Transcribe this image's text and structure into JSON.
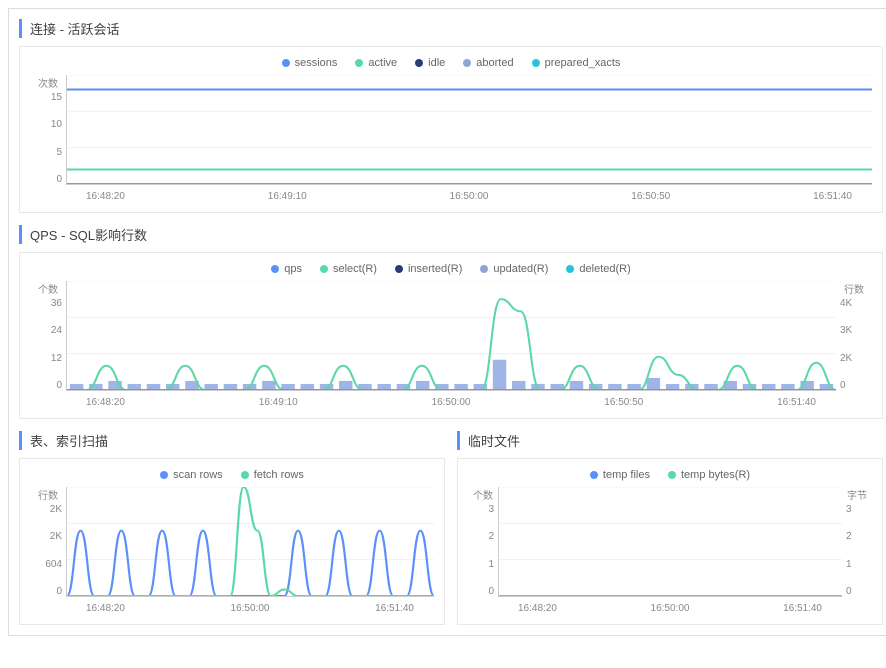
{
  "panels": {
    "sessions": {
      "title": "连接 - 活跃会话",
      "ylabel_left": "次数",
      "legend": [
        {
          "name": "sessions",
          "color": "#5b8ff9"
        },
        {
          "name": "active",
          "color": "#5ad8a6"
        },
        {
          "name": "idle",
          "color": "#2b3b7a"
        },
        {
          "name": "aborted",
          "color": "#8fa4d6"
        },
        {
          "name": "prepared_xacts",
          "color": "#29c3d8"
        }
      ]
    },
    "qps": {
      "title": "QPS - SQL影响行数",
      "ylabel_left": "个数",
      "ylabel_right": "行数",
      "legend": [
        {
          "name": "qps",
          "color": "#5b8ff9"
        },
        {
          "name": "select(R)",
          "color": "#5ad8a6"
        },
        {
          "name": "inserted(R)",
          "color": "#2b3b7a"
        },
        {
          "name": "updated(R)",
          "color": "#8fa4d6"
        },
        {
          "name": "deleted(R)",
          "color": "#29c3d8"
        }
      ]
    },
    "scan": {
      "title": "表、索引扫描",
      "ylabel_left": "行数",
      "legend": [
        {
          "name": "scan rows",
          "color": "#5b8ff9"
        },
        {
          "name": "fetch rows",
          "color": "#5ad8a6"
        }
      ]
    },
    "temp": {
      "title": "临时文件",
      "ylabel_left": "个数",
      "ylabel_right": "字节",
      "legend": [
        {
          "name": "temp files",
          "color": "#5b8ff9"
        },
        {
          "name": "temp bytes(R)",
          "color": "#5ad8a6"
        }
      ]
    }
  },
  "chart_data": [
    {
      "id": "sessions",
      "type": "line",
      "title": "连接 - 活跃会话",
      "xlabel": "",
      "ylabel": "次数",
      "ylim": [
        0,
        15
      ],
      "yticks": [
        0,
        5,
        10,
        15
      ],
      "x_ticks": [
        "16:48:20",
        "16:49:10",
        "16:50:00",
        "16:50:50",
        "16:51:40"
      ],
      "series": [
        {
          "name": "sessions",
          "color": "#5b8ff9",
          "flat_value": 13
        },
        {
          "name": "active",
          "color": "#5ad8a6",
          "flat_value": 2
        },
        {
          "name": "idle",
          "color": "#2b3b7a",
          "flat_value": 0
        },
        {
          "name": "aborted",
          "color": "#8fa4d6",
          "flat_value": 0
        },
        {
          "name": "prepared_xacts",
          "color": "#29c3d8",
          "flat_value": 0
        }
      ]
    },
    {
      "id": "qps",
      "type": "bar+line",
      "title": "QPS - SQL影响行数",
      "xlabel": "",
      "ylabel_left": "个数",
      "ylabel_right": "行数",
      "ylim_left": [
        0,
        36
      ],
      "yticks_left": [
        0,
        12,
        24,
        36
      ],
      "ylim_right": [
        0,
        4000
      ],
      "yticks_right": [
        "0",
        "2K",
        "3K",
        "4K"
      ],
      "x_ticks": [
        "16:48:20",
        "16:49:10",
        "16:50:00",
        "16:50:50",
        "16:51:40"
      ],
      "bar_series": {
        "name": "qps",
        "color": "#8fa4d6",
        "values": [
          2,
          2,
          3,
          2,
          2,
          2,
          3,
          2,
          2,
          2,
          3,
          2,
          2,
          2,
          3,
          2,
          2,
          2,
          3,
          2,
          2,
          2,
          10,
          3,
          2,
          2,
          3,
          2,
          2,
          2,
          4,
          2,
          2,
          2,
          3,
          2,
          2,
          2,
          3,
          2
        ]
      },
      "line_series": [
        {
          "name": "select(R)",
          "color": "#5ad8a6",
          "values": [
            0,
            0,
            8,
            0,
            0,
            0,
            8,
            0,
            0,
            0,
            8,
            0,
            0,
            0,
            8,
            0,
            0,
            0,
            8,
            0,
            0,
            0,
            30,
            26,
            0,
            0,
            8,
            0,
            0,
            0,
            11,
            5,
            0,
            0,
            8,
            0,
            0,
            0,
            9,
            0
          ]
        },
        {
          "name": "inserted(R)",
          "color": "#2b3b7a",
          "flat_value": 0
        },
        {
          "name": "updated(R)",
          "color": "#8fa4d6",
          "flat_value": 0
        },
        {
          "name": "deleted(R)",
          "color": "#29c3d8",
          "flat_value": 0
        }
      ]
    },
    {
      "id": "scan",
      "type": "line",
      "title": "表、索引扫描",
      "xlabel": "",
      "ylabel": "行数",
      "ylim": [
        0,
        2000
      ],
      "yticks": [
        "0",
        "604",
        "2K",
        "2K"
      ],
      "x_ticks": [
        "16:48:20",
        "16:50:00",
        "16:51:40"
      ],
      "series": [
        {
          "name": "scan rows",
          "color": "#5b8ff9",
          "values": [
            0,
            1200,
            0,
            0,
            1200,
            0,
            0,
            1200,
            0,
            0,
            1200,
            0,
            0,
            0,
            0,
            0,
            0,
            1200,
            0,
            0,
            1200,
            0,
            0,
            1200,
            0,
            0,
            1200,
            0
          ]
        },
        {
          "name": "fetch rows",
          "color": "#5ad8a6",
          "values": [
            0,
            0,
            0,
            0,
            0,
            0,
            0,
            0,
            0,
            0,
            0,
            0,
            0,
            2000,
            1200,
            0,
            120,
            0,
            0,
            0,
            0,
            0,
            0,
            0,
            0,
            0,
            0,
            0
          ]
        }
      ]
    },
    {
      "id": "temp",
      "type": "line",
      "title": "临时文件",
      "xlabel": "",
      "ylabel_left": "个数",
      "ylabel_right": "字节",
      "ylim_left": [
        0,
        3
      ],
      "yticks_left": [
        0,
        1,
        2,
        3
      ],
      "ylim_right": [
        0,
        3
      ],
      "yticks_right": [
        0,
        1,
        2,
        3
      ],
      "x_ticks": [
        "16:48:20",
        "16:50:00",
        "16:51:40"
      ],
      "series": [
        {
          "name": "temp files",
          "color": "#5b8ff9",
          "flat_value": 0
        },
        {
          "name": "temp bytes(R)",
          "color": "#5ad8a6",
          "flat_value": 0
        }
      ]
    }
  ]
}
